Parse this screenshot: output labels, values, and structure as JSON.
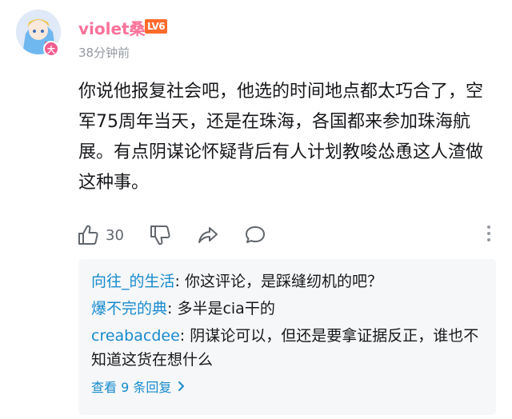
{
  "comment": {
    "username": "violet桑",
    "level": "LV6",
    "avatar_badge": "大",
    "time": "38分钟前",
    "text": "你说他报复社会吧，他选的时间地点都太巧合了，空军75周年当天，还是在珠海，各国都来参加珠海航展。有点阴谋论怀疑背后有人计划教唆怂恿这人渣做这种事。",
    "like_count": "30"
  },
  "replies": [
    {
      "name": "向往_的生活",
      "text": ": 你这评论，是踩缝纫机的吧？"
    },
    {
      "name": "爆不完的典",
      "text": ": 多半是cia干的"
    },
    {
      "name": "creabacdee",
      "text": ": 阴谋论可以，但还是要拿证据反正，谁也不知道这货在想什么"
    }
  ],
  "view_more_label": "查看 9 条回复",
  "colors": {
    "username": "#fb7299",
    "level_badge": "#ff6b2c",
    "reply_name": "#178bcf",
    "reply_bg": "#f6f7f8"
  },
  "icons": {
    "like": "thumbs-up-icon",
    "dislike": "thumbs-down-icon",
    "share": "share-icon",
    "reply": "comment-bubble-icon",
    "more": "more-vertical-icon",
    "chevron": "chevron-right-icon"
  }
}
